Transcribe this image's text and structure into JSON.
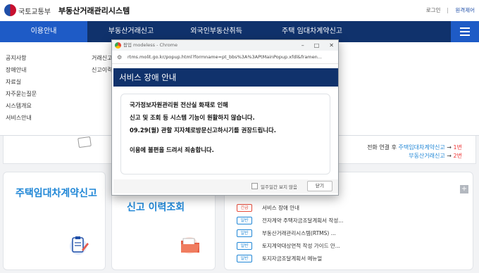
{
  "header": {
    "gov_name": "국토교통부",
    "system_title": "부동산거래관리시스템",
    "login": "로그인",
    "remote": "원격제어"
  },
  "nav": {
    "items": [
      "이용안내",
      "부동산거래신고",
      "외국인부동산취득",
      "주택 임대차계약신고"
    ]
  },
  "dropdown": {
    "col1": [
      "공지사항",
      "장애안내",
      "자료실",
      "자주묻는질문",
      "시스템개요",
      "서비스안내"
    ],
    "col2": [
      "거래신고",
      "신고이력"
    ]
  },
  "info": {
    "line1_prefix": "전화 연결 후",
    "line1_link": "주택임대차계약신고",
    "line1_num": "1번",
    "line2_link": "부동산거래신고",
    "line2_num": "2번",
    "arrow": "→"
  },
  "cards": {
    "rental_title": "주택임대차계약신고",
    "history_title": "신고 이력조회"
  },
  "notices": [
    {
      "tag": "긴급",
      "type": "urgent",
      "text": "서비스 장애 안내"
    },
    {
      "tag": "일반",
      "type": "normal",
      "text": "전자계약 주택자금조달계획서 작성..."
    },
    {
      "tag": "일반",
      "type": "normal",
      "text": "부동산거래관리시스템(RTMS) ..."
    },
    {
      "tag": "일반",
      "type": "normal",
      "text": "토지계약대상면적 작성 가이드 안..."
    },
    {
      "tag": "일반",
      "type": "normal",
      "text": "토지자금조달계획서 메뉴얼"
    }
  ],
  "popup": {
    "window_title": "팝업 modeless - Chrome",
    "url": "rtms.molit.go.kr/popup.html?formname=pt_bbs%3A%3APtMainPopup.xfdl&framen...",
    "header": "서비스 장애 안내",
    "lines": [
      "국가정보자원관리원 전산실 화재로 인해",
      "신고 및 조회 등 시스템 기능이 원활하지 않습니다.",
      "09.29(월) 관할 지자체로방문신고하시기를 권장드립니다.",
      "이용에 불편을 드려서 죄송합니다."
    ],
    "checkbox_label": "일주일간 보지 않음",
    "close_label": "닫기"
  },
  "colors": {
    "nav_bg": "#10326c",
    "nav_active": "#1e5bc6",
    "accent": "#1f86d6",
    "urgent": "#e74c3c"
  }
}
